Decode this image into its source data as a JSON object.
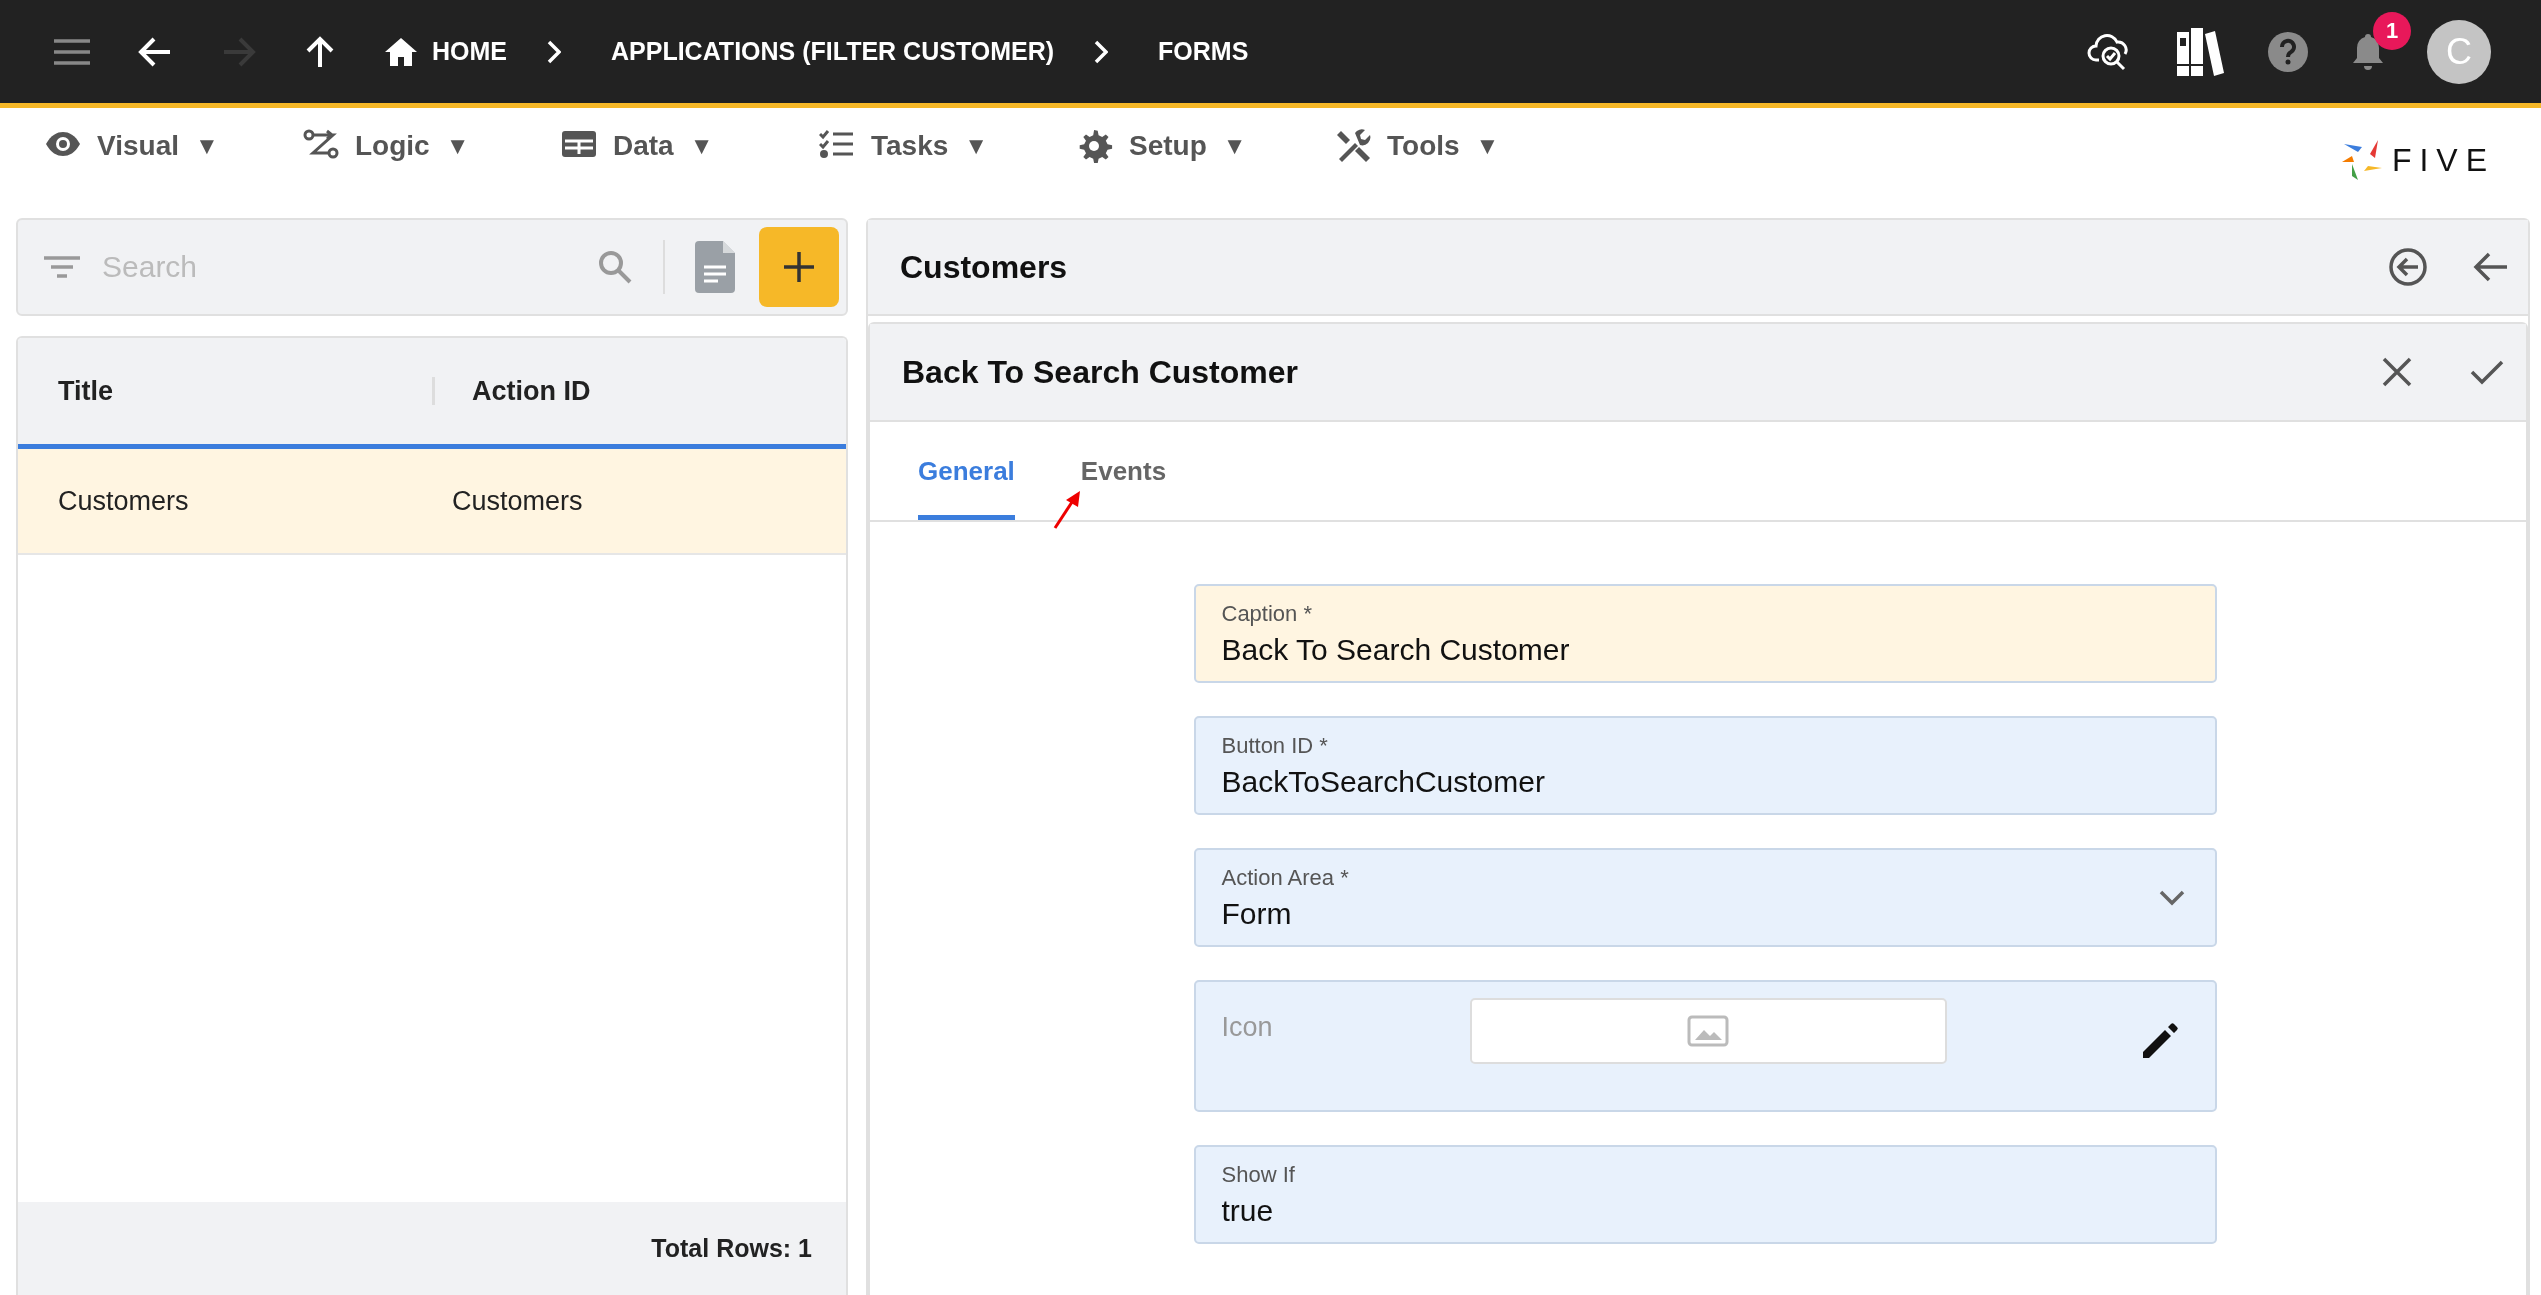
{
  "topbar": {
    "forward": {
      "disabled": true
    },
    "breadcrumbs": [
      {
        "label": "HOME",
        "kind": "home"
      },
      {
        "label": "APPLICATIONS (FILTER CUSTOMER)",
        "kind": "plain"
      },
      {
        "label": "FORMS",
        "kind": "plain"
      }
    ],
    "notifications": {
      "count": "1"
    },
    "avatar": {
      "initial": "C"
    }
  },
  "menu": [
    {
      "label": "Visual",
      "caret": "▼"
    },
    {
      "label": "Logic",
      "caret": "▼"
    },
    {
      "label": "Data",
      "caret": "▼"
    },
    {
      "label": "Tasks",
      "caret": "▼"
    },
    {
      "label": "Setup",
      "caret": "▼"
    },
    {
      "label": "Tools",
      "caret": "▼"
    }
  ],
  "logo": {
    "text": "FIVE"
  },
  "search": {
    "placeholder": "Search"
  },
  "list": {
    "columns": [
      "Title",
      "Action ID"
    ],
    "rows": [
      {
        "cells": [
          "Customers",
          "Customers"
        ],
        "selected": true
      }
    ],
    "footer": "Total Rows: 1"
  },
  "panel": {
    "title": "Customers"
  },
  "form": {
    "title": "Back To Search Customer",
    "tabs": [
      {
        "label": "General",
        "selected": true
      },
      {
        "label": "Events",
        "selected": false
      }
    ],
    "fields": [
      {
        "kind": "text",
        "label": "Caption *",
        "value": "Back To Search Customer",
        "focused": true
      },
      {
        "kind": "text",
        "label": "Button ID *",
        "value": "BackToSearchCustomer",
        "focused": false
      },
      {
        "kind": "select",
        "label": "Action Area *",
        "value": "Form",
        "focused": false
      },
      {
        "kind": "image",
        "label": "Icon",
        "focused": false
      },
      {
        "kind": "text",
        "label": "Show If",
        "value": "true",
        "focused": false
      }
    ]
  }
}
